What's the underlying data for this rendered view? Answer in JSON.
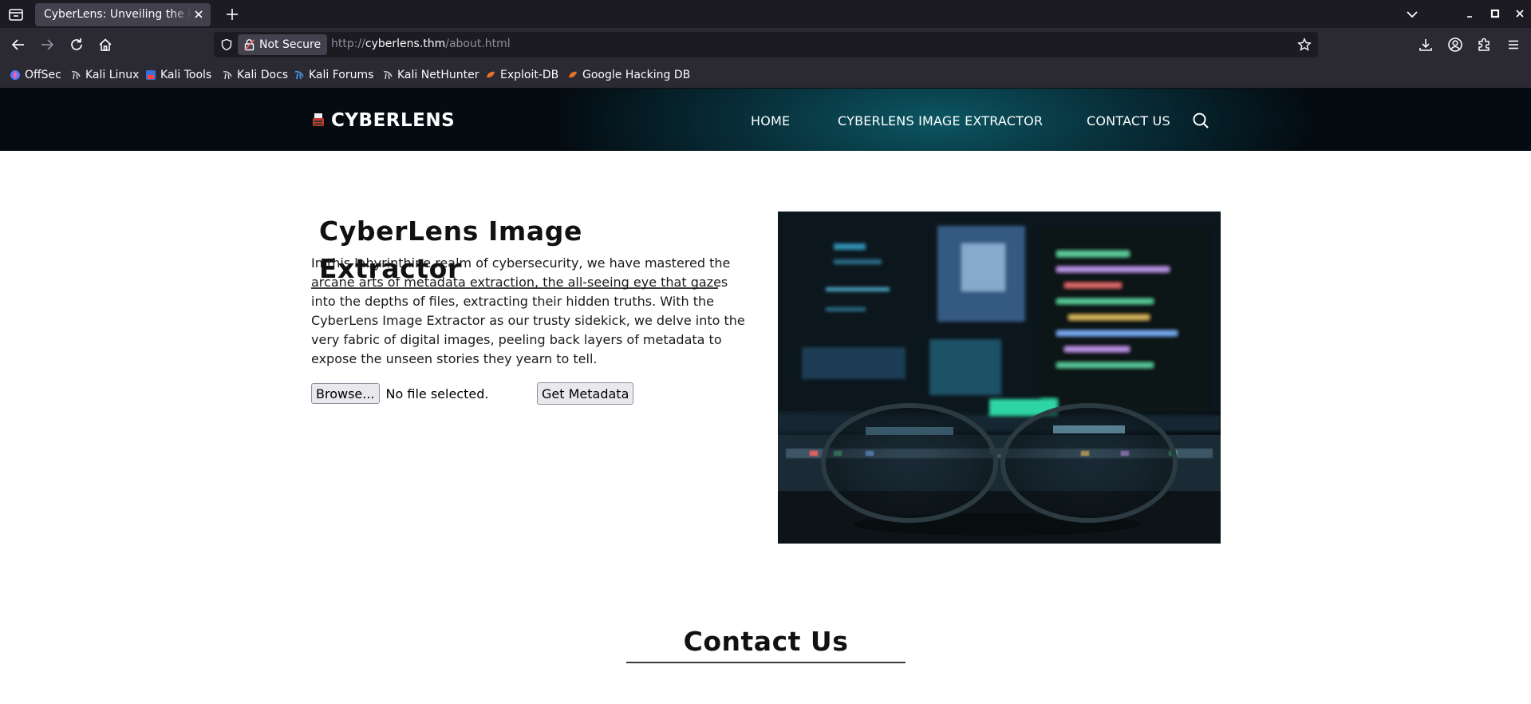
{
  "browser": {
    "tab": {
      "title": "CyberLens: Unveiling the Hidden Matrix"
    },
    "urlbar": {
      "security_label": "Not Secure",
      "url_scheme": "http://",
      "url_host": "cyberlens.thm",
      "url_path": "/about.html"
    },
    "bookmarks": [
      {
        "label": "OffSec",
        "icon": "offsec-icon"
      },
      {
        "label": "Kali Linux",
        "icon": "kali-dragon-icon"
      },
      {
        "label": "Kali Tools",
        "icon": "kali-tools-icon"
      },
      {
        "label": "Kali Docs",
        "icon": "kali-dragon-icon"
      },
      {
        "label": "Kali Forums",
        "icon": "kali-forums-icon"
      },
      {
        "label": "Kali NetHunter",
        "icon": "kali-dragon-icon"
      },
      {
        "label": "Exploit-DB",
        "icon": "exploit-db-icon"
      },
      {
        "label": "Google Hacking DB",
        "icon": "exploit-db-icon"
      }
    ]
  },
  "site": {
    "logo_text": "CYBERLENS",
    "nav": [
      {
        "label": "HOME"
      },
      {
        "label": "CYBERLENS IMAGE EXTRACTOR"
      },
      {
        "label": "CONTACT US"
      }
    ]
  },
  "about": {
    "title": "CyberLens Image Extractor",
    "paragraph": "In this labyrinthine realm of cybersecurity, we have mastered the arcane arts of metadata extraction, the all-seeing eye that gazes into the depths of files, extracting their hidden truths. With the CyberLens Image Extractor as our trusty sidekick, we delve into the very fabric of digital images, peeling back layers of metadata to expose the unseen stories they yearn to tell.",
    "browse_label": "Browse...",
    "file_status": "No file selected.",
    "submit_label": "Get Metadata"
  },
  "contact": {
    "title": "Contact Us"
  },
  "colors": {
    "chrome_dark": "#1c1b22",
    "chrome_mid": "#2b2a33",
    "header_teal": "#0b5662",
    "header_dark": "#040b11"
  }
}
